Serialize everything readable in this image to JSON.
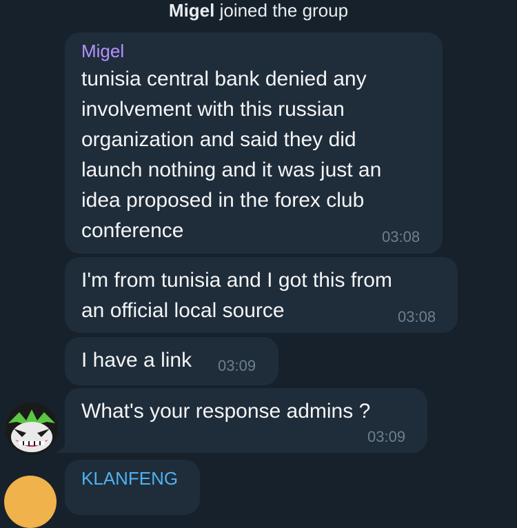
{
  "service_message": {
    "name": "Migel",
    "action": " joined the group"
  },
  "messages": [
    {
      "sender": "Migel",
      "lines": [
        "tunisia central bank denied any",
        "involvement with this russian",
        "organization and said they did",
        "launch nothing and it was just an",
        "idea proposed in the forex club",
        "conference"
      ],
      "time": "03:08"
    },
    {
      "lines": [
        "I'm from tunisia and I got this from",
        "an official local source"
      ],
      "time": "03:08"
    },
    {
      "lines": [
        "I have a link"
      ],
      "time": "03:09"
    },
    {
      "lines": [
        "What's your response admins ?"
      ],
      "time": "03:09"
    },
    {
      "sender": "KLANFENG"
    }
  ],
  "avatars": {
    "joker": "joker-avatar-icon",
    "next": "user-avatar-icon"
  }
}
